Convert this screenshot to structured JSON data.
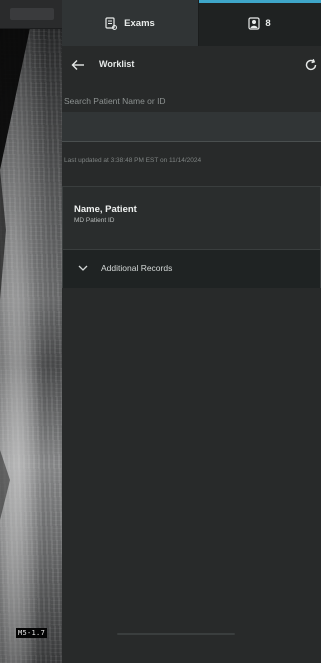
{
  "ultrasound": {
    "scale_label": "M5-1.7"
  },
  "tabs": [
    {
      "label": "Exams",
      "icon": "exam-list-icon",
      "active": true
    },
    {
      "label": "",
      "icon": "patient-icon",
      "count": "8",
      "active": false
    }
  ],
  "header": {
    "title": "Worklist",
    "back_icon": "arrow-left-icon",
    "refresh_icon": "refresh-icon"
  },
  "search": {
    "label": "Search Patient Name or ID",
    "value": ""
  },
  "last_updated": "Last updated at 3:38:48 PM EST on 11/14/2024",
  "patient": {
    "name": "Name, Patient",
    "id_line": "MD Patient ID"
  },
  "additional_records": {
    "label": "Additional Records",
    "icon": "chevron-down-icon"
  },
  "colors": {
    "accent": "#3ea6c9",
    "panel": "#282a2a",
    "tabbar": "#1f2222"
  }
}
